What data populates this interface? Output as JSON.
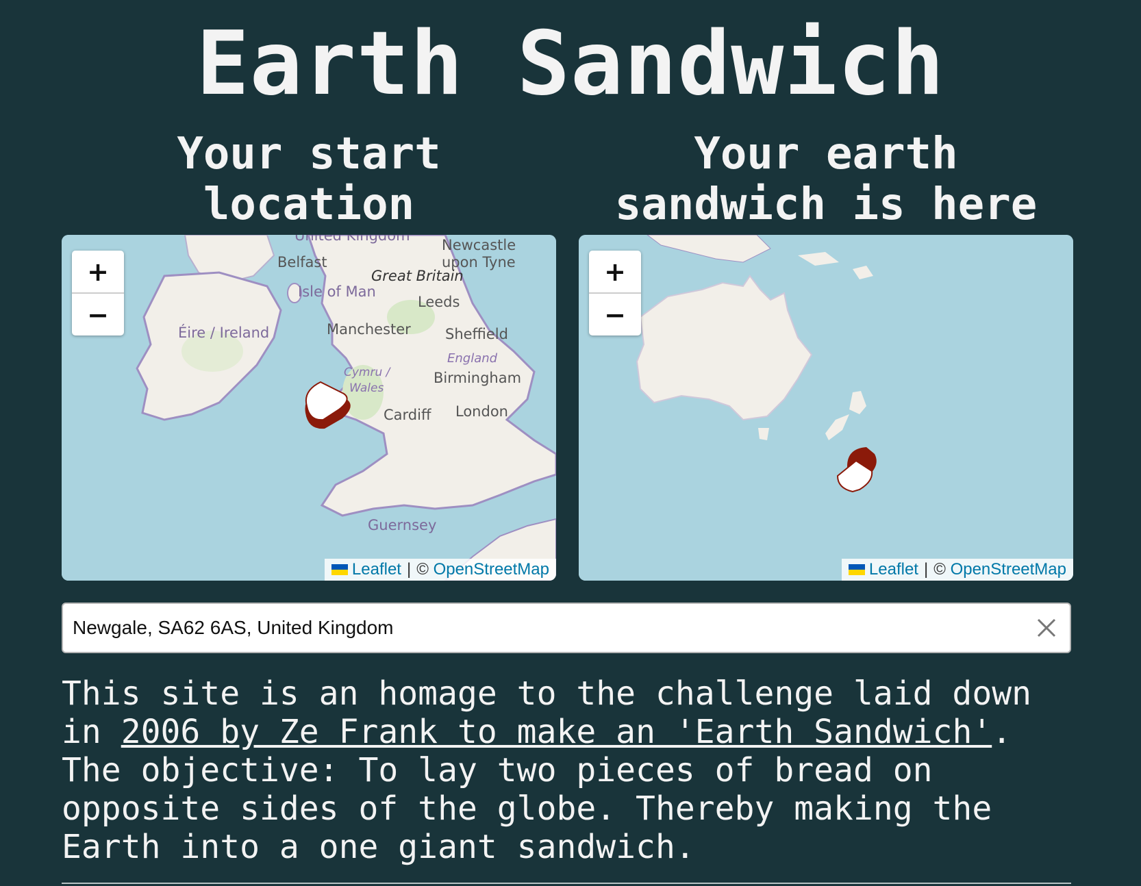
{
  "page": {
    "title": "Earth Sandwich"
  },
  "start_map": {
    "heading_line1": "Your start",
    "heading_line2": "location",
    "zoom_in": "+",
    "zoom_out": "−",
    "labels": {
      "united_kingdom": "United Kingdom",
      "newcastle_1": "Newcastle",
      "newcastle_2": "upon Tyne",
      "belfast": "Belfast",
      "great_britain": "Great Britain",
      "isle_of_man": "Isle of Man",
      "leeds": "Leeds",
      "ireland": "Éire / Ireland",
      "manchester": "Manchester",
      "sheffield": "Sheffield",
      "england": "England",
      "wales_1": "Cymru /",
      "wales_2": "Wales",
      "birmingham": "Birmingham",
      "cardiff": "Cardiff",
      "london": "London",
      "guernsey": "Guernsey"
    }
  },
  "antipode_map": {
    "heading_line1": "Your earth",
    "heading_line2": "sandwich is here",
    "zoom_in": "+",
    "zoom_out": "−"
  },
  "attribution": {
    "leaflet": "Leaflet",
    "separator": "|",
    "copyright": "©",
    "osm": "OpenStreetMap"
  },
  "search": {
    "value": "Newgale, SA62 6AS, United Kingdom",
    "clear_icon": "close-icon"
  },
  "intro": {
    "part1": "This site is an homage to the challenge laid down in ",
    "link": "2006 by Ze Frank to make an 'Earth Sandwich'",
    "part2": ". The objective: To lay two pieces of bread on opposite sides of the globe. Thereby making the Earth into a one giant sandwich."
  },
  "colors": {
    "background": "#19343a",
    "water": "#aad3df",
    "land": "#f2efe9",
    "border": "#9e8fc2",
    "bread_crust": "#8b1a0a"
  }
}
